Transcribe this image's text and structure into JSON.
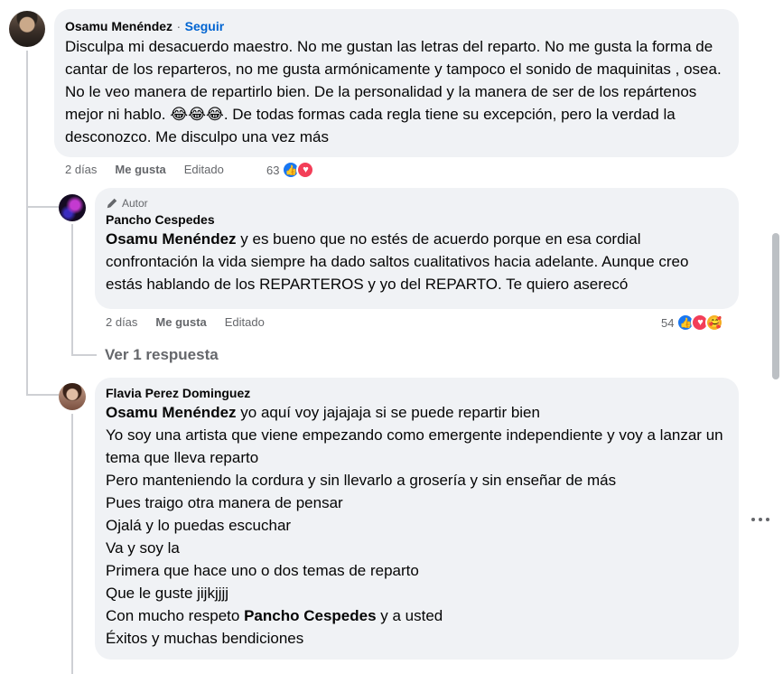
{
  "comments": [
    {
      "author": "Osamu Menéndez",
      "follow_label": "Seguir",
      "separator": "·",
      "text": "Disculpa mi desacuerdo maestro. No me gustan las letras del reparto. No me gusta la forma de cantar de los reparteros, no me gusta armónicamente y tampoco el sonido de maquinitas , osea. No le veo manera de repartirlo bien. De la personalidad y la manera de ser de los repártenos mejor ni hablo. 😂😂😂. De todas formas cada regla tiene su excepción, pero la verdad la desconozco. Me disculpo una vez más",
      "time": "2 días",
      "like_label": "Me gusta",
      "edited_label": "Editado",
      "reaction_count": "63",
      "reactions": [
        "like-icon",
        "love-icon"
      ]
    },
    {
      "badge": "Autor",
      "author": "Pancho Cespedes",
      "mention": "Osamu Menéndez",
      "text": " y es bueno que no estés de acuerdo porque en esa cordial confrontación la vida siempre ha dado saltos cualitativos hacia adelante. Aunque creo estás hablando de los REPARTEROS y yo del REPARTO. Te quiero aserecó",
      "time": "2 días",
      "like_label": "Me gusta",
      "edited_label": "Editado",
      "reaction_count": "54",
      "reactions": [
        "like-icon",
        "love-icon",
        "care-icon"
      ],
      "replies_label": "Ver 1 respuesta"
    },
    {
      "author": "Flavia Perez Dominguez",
      "mention": "Osamu Menéndez",
      "first_line": " yo aquí voy jajajaja si se puede repartir bien",
      "lines": [
        "Yo soy una artista que viene empezando como emergente independiente y voy a lanzar un tema que lleva reparto",
        "Pero manteniendo la cordura y sin llevarlo a grosería y sin enseñar de más",
        "Pues traigo otra manera de pensar",
        "Ojalá y lo puedas escuchar",
        "Va y soy la",
        "Primera que hace uno o dos temas de reparto",
        "Que le guste jijkjjjj"
      ],
      "respect_prefix": "Con mucho respeto ",
      "respect_mention": "Pancho Cespedes",
      "respect_suffix": " y a usted",
      "last_line": "Éxitos y muchas bendiciones"
    }
  ],
  "colors": {
    "bubble": "#f0f2f5",
    "link": "#0064d1",
    "meta": "#65676b",
    "like": "#1877f2",
    "love": "#f33e58",
    "care": "#f7b125"
  }
}
